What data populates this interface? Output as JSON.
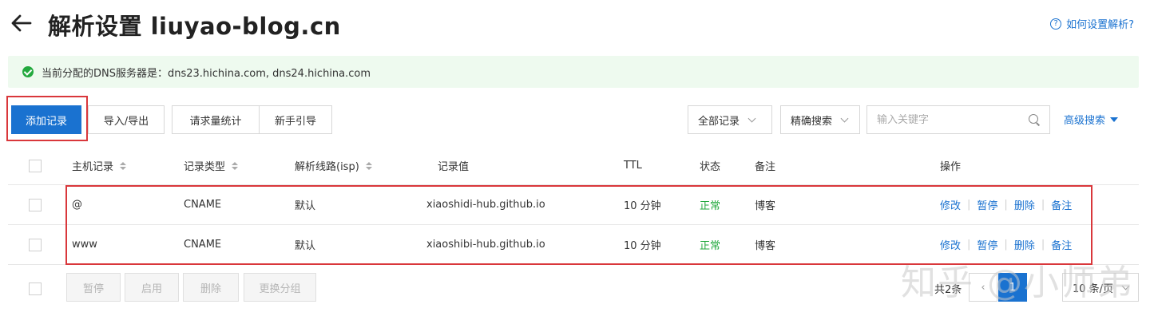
{
  "header": {
    "title": "解析设置 liuyao-blog.cn",
    "help_link": "如何设置解析?"
  },
  "notice": {
    "text": "当前分配的DNS服务器是：dns23.hichina.com, dns24.hichina.com"
  },
  "toolbar": {
    "add_record": "添加记录",
    "import_export": "导入/导出",
    "request_stats": "请求量统计",
    "beginner_guide": "新手引导",
    "filter_select": "全部记录",
    "search_mode": "精确搜索",
    "search_placeholder": "输入关键字",
    "advanced_search": "高级搜索"
  },
  "table": {
    "columns": [
      "主机记录",
      "记录类型",
      "解析线路(isp)",
      "记录值",
      "TTL",
      "状态",
      "备注",
      "操作"
    ],
    "rows": [
      {
        "host": "@",
        "type": "CNAME",
        "line": "默认",
        "value": "xiaoshidi-hub.github.io",
        "ttl": "10 分钟",
        "status": "正常",
        "remark": "博客"
      },
      {
        "host": "www",
        "type": "CNAME",
        "line": "默认",
        "value": "xiaoshibi-hub.github.io",
        "ttl": "10 分钟",
        "status": "正常",
        "remark": "博客"
      }
    ],
    "actions": [
      "修改",
      "暂停",
      "删除",
      "备注"
    ]
  },
  "footer": {
    "bulk_actions": [
      "暂停",
      "启用",
      "删除",
      "更换分组"
    ],
    "total": "共2条",
    "page_current": "1",
    "page_size": "10 条/页"
  },
  "watermark": "知乎 @小师弟",
  "colors": {
    "primary": "#1a72d0",
    "success": "#23a93e",
    "highlight": "#d9373b",
    "notice_bg": "#eefaef"
  }
}
